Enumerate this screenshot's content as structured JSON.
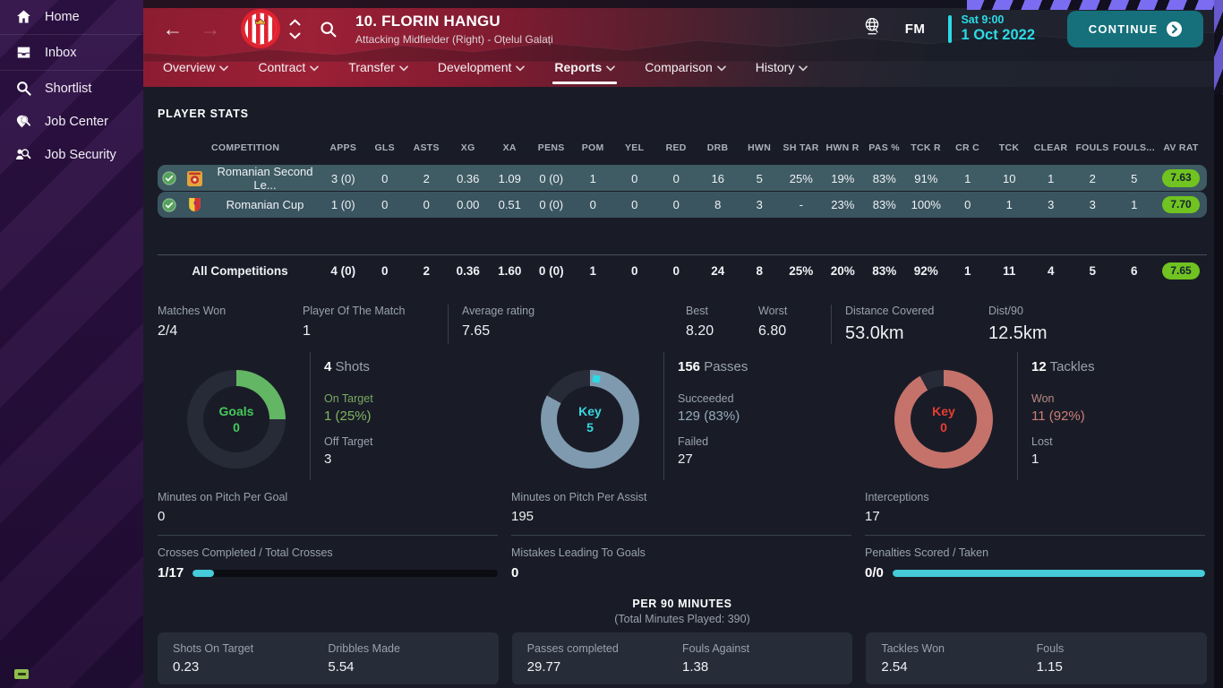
{
  "colors": {
    "accent_cyan": "#2bdbe6",
    "rating_green": "#70c320",
    "continue_teal": "#15707b",
    "row_teal": "#3f5b64",
    "donut_track": "#262b37"
  },
  "sidebar": {
    "items": [
      {
        "label": "Home",
        "icon": "home-icon"
      },
      {
        "label": "Inbox",
        "icon": "inbox-icon"
      },
      {
        "label": "Shortlist",
        "icon": "shortlist-icon"
      },
      {
        "label": "Job Center",
        "icon": "job-center-icon"
      },
      {
        "label": "Job Security",
        "icon": "job-security-icon"
      }
    ]
  },
  "topbar": {
    "player_title": "10. FLORIN HANGU",
    "player_subtitle": "Attacking Midfielder (Right) - Oțelul Galați",
    "fm_label": "FM",
    "day_time": "Sat 9:00",
    "date": "1 Oct 2022",
    "continue_label": "CONTINUE"
  },
  "tabs": [
    {
      "label": "Overview",
      "active": false
    },
    {
      "label": "Contract",
      "active": false
    },
    {
      "label": "Transfer",
      "active": false
    },
    {
      "label": "Development",
      "active": false
    },
    {
      "label": "Reports",
      "active": true
    },
    {
      "label": "Comparison",
      "active": false
    },
    {
      "label": "History",
      "active": false
    }
  ],
  "section_title": "PLAYER STATS",
  "table": {
    "columns": [
      "COMPETITION",
      "APPS",
      "GLS",
      "ASTS",
      "XG",
      "XA",
      "PENS",
      "POM",
      "YEL",
      "RED",
      "DRB",
      "HWN",
      "SH TAR",
      "HWN R",
      "PAS %",
      "TCK R",
      "CR C",
      "TCK",
      "CLEAR",
      "FOULS",
      "FOULS...",
      "AV RAT"
    ],
    "rows": [
      {
        "icon": "league-logo",
        "name": "Romanian Second Le...",
        "values": [
          "3 (0)",
          "0",
          "2",
          "0.36",
          "1.09",
          "0 (0)",
          "1",
          "0",
          "0",
          "16",
          "5",
          "25%",
          "19%",
          "83%",
          "91%",
          "1",
          "10",
          "1",
          "2",
          "5"
        ],
        "rating": "7.63"
      },
      {
        "icon": "cup-logo",
        "name": "Romanian Cup",
        "values": [
          "1 (0)",
          "0",
          "0",
          "0.00",
          "0.51",
          "0 (0)",
          "0",
          "0",
          "0",
          "8",
          "3",
          "-",
          "23%",
          "83%",
          "100%",
          "0",
          "1",
          "3",
          "3",
          "1"
        ],
        "rating": "7.70"
      }
    ],
    "total": {
      "name": "All Competitions",
      "values": [
        "4 (0)",
        "0",
        "2",
        "0.36",
        "1.60",
        "0 (0)",
        "1",
        "0",
        "0",
        "24",
        "8",
        "25%",
        "20%",
        "83%",
        "92%",
        "1",
        "11",
        "4",
        "5",
        "6"
      ],
      "rating": "7.65"
    }
  },
  "summary": [
    {
      "label": "Matches Won",
      "value": "2/4"
    },
    {
      "label": "Player Of The Match",
      "value": "1"
    },
    {
      "label": "Average rating",
      "value": "7.65"
    },
    {
      "label": "Best",
      "value": "8.20"
    },
    {
      "label": "Worst",
      "value": "6.80"
    },
    {
      "label": "Distance Covered",
      "value": "53.0km"
    },
    {
      "label": "Dist/90",
      "value": "12.5km"
    }
  ],
  "donuts": [
    {
      "center_top": "Goals",
      "center_val": "0",
      "center_color": "#46c95a",
      "ring_color": "#63b663",
      "pct": 25,
      "marker": false,
      "stat_number": "4",
      "stat_word": "Shots",
      "rows": [
        {
          "label": "On Target",
          "value": "1 (25%)"
        },
        {
          "label": "Off Target",
          "value": "3"
        }
      ]
    },
    {
      "center_top": "Key",
      "center_val": "5",
      "center_color": "#38d8e0",
      "ring_color": "#7f9aae",
      "pct": 83,
      "marker": true,
      "stat_number": "156",
      "stat_word": "Passes",
      "rows": [
        {
          "label": "Succeeded",
          "value": "129 (83%)"
        },
        {
          "label": "Failed",
          "value": "27"
        }
      ]
    },
    {
      "center_top": "Key",
      "center_val": "0",
      "center_color": "#ea3d33",
      "ring_color": "#c5726b",
      "pct": 92,
      "marker": false,
      "stat_number": "12",
      "stat_word": "Tackles",
      "rows": [
        {
          "label": "Won",
          "value": "11 (92%)"
        },
        {
          "label": "Lost",
          "value": "1"
        }
      ]
    }
  ],
  "midstats": [
    {
      "top": {
        "label": "Minutes on Pitch Per Goal",
        "value": "0"
      },
      "bottom": {
        "label": "Crosses Completed / Total Crosses",
        "value": "1/17",
        "bar_pct": 7
      }
    },
    {
      "top": {
        "label": "Minutes on Pitch Per Assist",
        "value": "195"
      },
      "bottom": {
        "label": "Mistakes Leading To Goals",
        "value": "0"
      }
    },
    {
      "top": {
        "label": "Interceptions",
        "value": "17"
      },
      "bottom": {
        "label": "Penalties Scored / Taken",
        "value": "0/0",
        "bar_pct": 100
      }
    }
  ],
  "per90": {
    "title": "PER 90 MINUTES",
    "subtitle": "(Total Minutes Played: 390)",
    "cards": [
      {
        "stats": [
          {
            "label": "Shots On Target",
            "value": "0.23"
          },
          {
            "label": "Dribbles Made",
            "value": "5.54"
          }
        ]
      },
      {
        "stats": [
          {
            "label": "Passes completed",
            "value": "29.77"
          },
          {
            "label": "Fouls Against",
            "value": "1.38"
          }
        ]
      },
      {
        "stats": [
          {
            "label": "Tackles Won",
            "value": "2.54"
          },
          {
            "label": "Fouls",
            "value": "1.15"
          }
        ]
      }
    ]
  }
}
